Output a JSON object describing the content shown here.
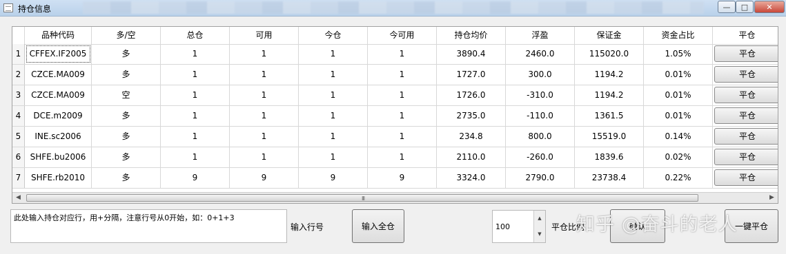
{
  "window": {
    "title": "持仓信息",
    "buttons": {
      "minimize": "—",
      "maximize": "□",
      "close": "✕"
    }
  },
  "table": {
    "headers": [
      "品种代码",
      "多/空",
      "总仓",
      "可用",
      "今仓",
      "今可用",
      "持仓均价",
      "浮盈",
      "保证金",
      "资金占比",
      "平仓"
    ],
    "rows": [
      {
        "num": "1",
        "code": "CFFEX.IF2005",
        "dir": "多",
        "total": "1",
        "avail": "1",
        "today": "1",
        "today_avail": "1",
        "avg_price": "3890.4",
        "pnl": "2460.0",
        "margin": "115020.0",
        "ratio": "1.05%",
        "action": "平仓"
      },
      {
        "num": "2",
        "code": "CZCE.MA009",
        "dir": "多",
        "total": "1",
        "avail": "1",
        "today": "1",
        "today_avail": "1",
        "avg_price": "1727.0",
        "pnl": "300.0",
        "margin": "1194.2",
        "ratio": "0.01%",
        "action": "平仓"
      },
      {
        "num": "3",
        "code": "CZCE.MA009",
        "dir": "空",
        "total": "1",
        "avail": "1",
        "today": "1",
        "today_avail": "1",
        "avg_price": "1726.0",
        "pnl": "-310.0",
        "margin": "1194.2",
        "ratio": "0.01%",
        "action": "平仓"
      },
      {
        "num": "4",
        "code": "DCE.m2009",
        "dir": "多",
        "total": "1",
        "avail": "1",
        "today": "1",
        "today_avail": "1",
        "avg_price": "2735.0",
        "pnl": "-110.0",
        "margin": "1361.5",
        "ratio": "0.01%",
        "action": "平仓"
      },
      {
        "num": "5",
        "code": "INE.sc2006",
        "dir": "多",
        "total": "1",
        "avail": "1",
        "today": "1",
        "today_avail": "1",
        "avg_price": "234.8",
        "pnl": "800.0",
        "margin": "15519.0",
        "ratio": "0.14%",
        "action": "平仓"
      },
      {
        "num": "6",
        "code": "SHFE.bu2006",
        "dir": "多",
        "total": "1",
        "avail": "1",
        "today": "1",
        "today_avail": "1",
        "avg_price": "2110.0",
        "pnl": "-260.0",
        "margin": "1839.6",
        "ratio": "0.02%",
        "action": "平仓"
      },
      {
        "num": "7",
        "code": "SHFE.rb2010",
        "dir": "多",
        "total": "9",
        "avail": "9",
        "today": "9",
        "today_avail": "9",
        "avg_price": "3324.0",
        "pnl": "2790.0",
        "margin": "23738.4",
        "ratio": "0.22%",
        "action": "平仓"
      }
    ],
    "scroll_grip": "III"
  },
  "controls": {
    "row_input_text": "此处输入持仓对应行，用+分隔，注意行号从0开始，如：0+1+3",
    "row_label": "输入行号",
    "close_all_button": "输入全仓",
    "quantity_value": "100",
    "ratio_label": "平仓比例",
    "confirm_button": "确认",
    "one_click_button": "一键平仓"
  },
  "watermark": "知乎 @奋斗的老人"
}
